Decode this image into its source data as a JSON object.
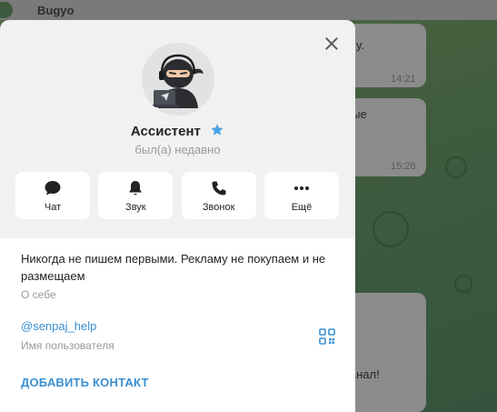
{
  "chat": {
    "title": "Bugyo",
    "messages": [
      {
        "text": "y.",
        "time": "14:21"
      },
      {
        "text": "ные",
        "time": "15:28"
      },
      {
        "text": "й канал!",
        "time": ""
      }
    ]
  },
  "profile": {
    "name": "Ассистент",
    "verified": true,
    "status": "был(а) недавно",
    "actions": [
      {
        "label": "Чат",
        "icon": "chat-bubble-icon"
      },
      {
        "label": "Звук",
        "icon": "bell-icon"
      },
      {
        "label": "Звонок",
        "icon": "phone-icon"
      },
      {
        "label": "Ещё",
        "icon": "more-dots-icon"
      }
    ],
    "bio": "Никогда не пишем первыми. Рекламу не покупаем и не размещаем",
    "bio_label": "О себе",
    "username": "@senpaj_help",
    "username_label": "Имя пользователя",
    "add_contact": "ДОБАВИТЬ КОНТАКТ"
  },
  "colors": {
    "accent": "#3a8fd0",
    "card_bg": "#f1f1f1",
    "star": "#4aa3e6"
  }
}
